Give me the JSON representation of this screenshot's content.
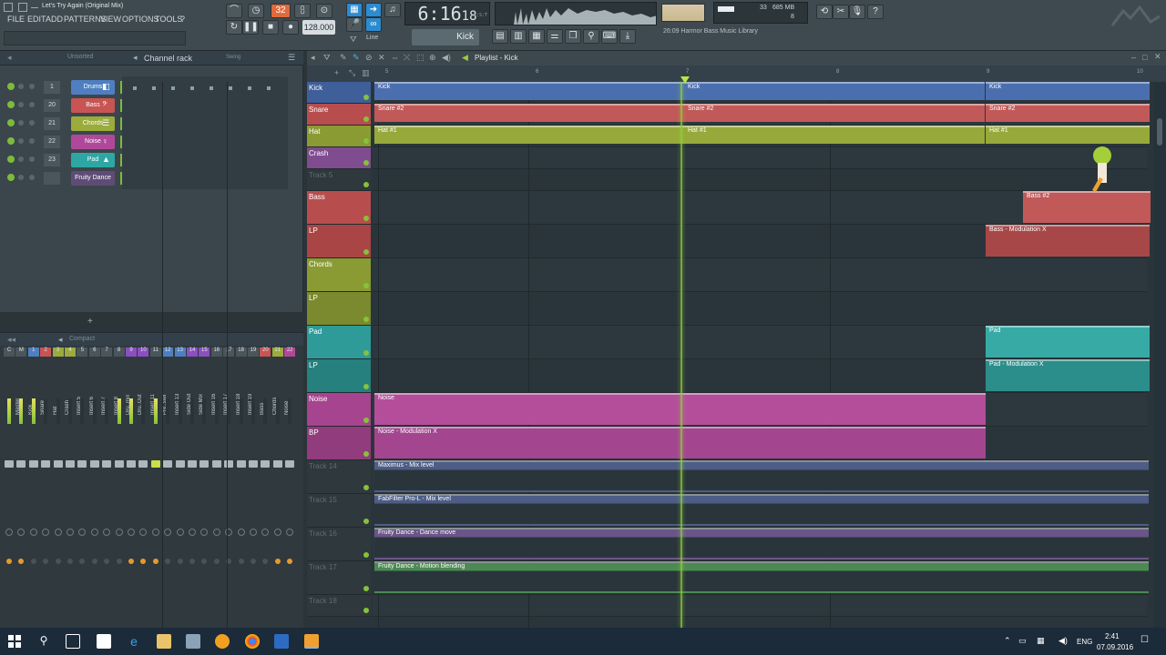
{
  "window": {
    "title": "Let's Try Again (Original Mix)"
  },
  "menu": [
    "FILE",
    "EDIT",
    "ADD",
    "PATTERNS",
    "VIEW",
    "OPTIONS",
    "TOOLS",
    "?"
  ],
  "transport": {
    "pattern": "32",
    "tempo": "128.000",
    "time_main": "6:16",
    "time_sub": "18",
    "time_unit": "B:S:T",
    "snap": "Line",
    "pattern_name": "Kick"
  },
  "cpu": {
    "cpu": "33",
    "mem": "685 MB",
    "poly": "8"
  },
  "hint": {
    "time": "26:09",
    "text": "Harmor Bass Music Library"
  },
  "channel_rack": {
    "title": "Channel rack",
    "filter": "Unsorted",
    "swing": "Swing",
    "channels": [
      {
        "num": "1",
        "name": "Drums",
        "color": "#4f7fc0",
        "icon": "drums-icon"
      },
      {
        "num": "20",
        "name": "Bass",
        "color": "#c85454",
        "icon": "bass-clef-icon"
      },
      {
        "num": "21",
        "name": "Chords",
        "color": "#9bab3c",
        "icon": "chords-icon"
      },
      {
        "num": "22",
        "name": "Noise",
        "color": "#b0489a",
        "icon": "noise-icon"
      },
      {
        "num": "23",
        "name": "Pad",
        "color": "#2ea7a4",
        "icon": "triangle-icon"
      },
      {
        "num": "",
        "name": "Fruity Dance",
        "color": "#5f4c76",
        "icon": ""
      }
    ]
  },
  "mixer": {
    "title": "Compact",
    "numbers": [
      "C",
      "M",
      "1",
      "2",
      "3",
      "4",
      "5",
      "6",
      "7",
      "8",
      "9",
      "10",
      "11",
      "12",
      "13",
      "14",
      "15",
      "16",
      "17",
      "18",
      "19",
      "20",
      "21",
      "22"
    ],
    "labels": [
      "Master",
      "Kick",
      "Snare",
      "Hat",
      "Crash",
      "Insert 5",
      "Insert 6",
      "Insert 7",
      "Insert 8",
      "Dru..mix",
      "Dru..Out",
      "Insert 11",
      "Pre..ster",
      "Insert 13",
      "Side Out",
      "Side Mix",
      "Insert 16",
      "Insert 17",
      "Insert 18",
      "Insert 19",
      "Bass",
      "Chords",
      "Noise"
    ]
  },
  "playlist": {
    "title": "Playlist - Kick",
    "bar_numbers": [
      "5",
      "6",
      "7",
      "8",
      "9",
      "10"
    ],
    "tracks": [
      {
        "name": "Kick",
        "color": "#3e5f9a",
        "dim": false
      },
      {
        "name": "Snare",
        "color": "#b84d4d",
        "dim": false
      },
      {
        "name": "Hat",
        "color": "#8a9b33",
        "dim": false
      },
      {
        "name": "Crash",
        "color": "#7f4c90",
        "dim": false
      },
      {
        "name": "Track 5",
        "color": "#2e383d",
        "dim": true
      },
      {
        "name": "Bass",
        "color": "#b84d4d",
        "dim": false
      },
      {
        "name": "LP",
        "color": "#a94545",
        "dim": false
      },
      {
        "name": "Chords",
        "color": "#8a9b33",
        "dim": false
      },
      {
        "name": "LP",
        "color": "#7b8a2e",
        "dim": false
      },
      {
        "name": "Pad",
        "color": "#2e9b98",
        "dim": false
      },
      {
        "name": "LP",
        "color": "#25807e",
        "dim": false
      },
      {
        "name": "Noise",
        "color": "#a6448f",
        "dim": false
      },
      {
        "name": "BP",
        "color": "#913c7d",
        "dim": false
      },
      {
        "name": "Track 14",
        "color": "#2e383d",
        "dim": true
      },
      {
        "name": "Track 15",
        "color": "#2e383d",
        "dim": true
      },
      {
        "name": "Track 16",
        "color": "#2e383d",
        "dim": true
      },
      {
        "name": "Track 17",
        "color": "#2e383d",
        "dim": true
      },
      {
        "name": "Track 18",
        "color": "#2e383d",
        "dim": true
      }
    ],
    "clips": [
      {
        "label": "Kick",
        "color": "#4b6fae"
      },
      {
        "label": "Kick",
        "color": "#4b6fae"
      },
      {
        "label": "Kick",
        "color": "#4b6fae"
      },
      {
        "label": "Snare #2",
        "color": "#c15959"
      },
      {
        "label": "Snare #2",
        "color": "#c15959"
      },
      {
        "label": "Snare #2",
        "color": "#c15959"
      },
      {
        "label": "Hat #1",
        "color": "#97a93b"
      },
      {
        "label": "Hat #1",
        "color": "#97a93b"
      },
      {
        "label": "Hat #1",
        "color": "#97a93b"
      },
      {
        "label": "Bass #2",
        "color": "#c15959"
      },
      {
        "label": "Bass - Modulation X",
        "color": "#a84747"
      },
      {
        "label": "Pad",
        "color": "#37aaa6"
      },
      {
        "label": "Pad - Modulation X",
        "color": "#2c8e8b"
      },
      {
        "label": "Noise",
        "color": "#b44e9b"
      },
      {
        "label": "Noise - Modulation X",
        "color": "#a44590"
      },
      {
        "label": "Maximus - Mix level",
        "color": "#4d5d86"
      },
      {
        "label": "FabFilter Pro-L - Mix level",
        "color": "#4d5d86"
      },
      {
        "label": "Fruity Dance - Dance move",
        "color": "#6a5588"
      },
      {
        "label": "Fruity Dance - Motion blending",
        "color": "#4b8a52"
      }
    ]
  },
  "taskbar": {
    "lang": "ENG",
    "time": "2:41",
    "date": "07.09.2016"
  }
}
